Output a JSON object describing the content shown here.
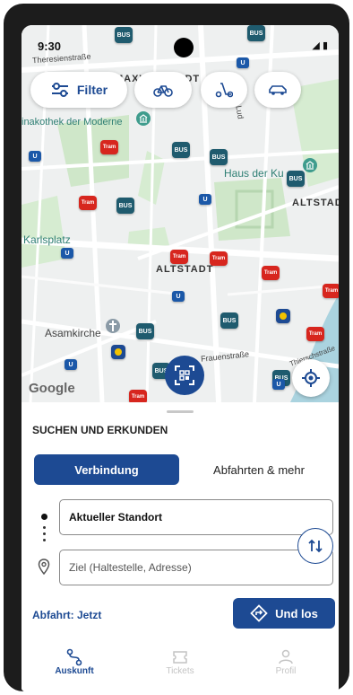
{
  "status_bar": {
    "time": "9:30",
    "indicators": "◢ ▮"
  },
  "filters": {
    "filter_label": "Filter",
    "bike_icon": "bike-icon",
    "scooter_icon": "scooter-icon",
    "car_icon": "car-icon"
  },
  "map": {
    "labels": {
      "maxvorstadt": "MAXVORSTADT",
      "theresienstrasse": "Theresienstraße",
      "pinakothek": "inakothek der Moderne",
      "ludwig": "Lud",
      "haus_der_kunst": "Haus der Ku",
      "altstadt_right": "ALTSTADT",
      "karlsplatz": "Karlsplatz",
      "altstadt_center": "ALTSTADT",
      "asamkirche": "Asamkirche",
      "frauenstrasse": "Frauenstraße",
      "thierschstrasse": "Thierschstraße"
    },
    "google_label": "Google",
    "bus_label": "BUS",
    "tram_label": "Tram",
    "ubahn_label": "U"
  },
  "sheet": {
    "title": "SUCHEN UND ERKUNDEN",
    "segments": {
      "active": "Verbindung",
      "inactive": "Abfahrten & mehr"
    },
    "from_value": "Aktueller Standort",
    "to_placeholder": "Ziel (Haltestelle, Adresse)",
    "departure": "Abfahrt: Jetzt",
    "go_button": "Und los"
  },
  "nav": {
    "items": [
      {
        "label": "Auskunft",
        "active": true
      },
      {
        "label": "Tickets",
        "active": false
      },
      {
        "label": "Profil",
        "active": false
      }
    ]
  },
  "colors": {
    "primary": "#1d4a93",
    "bus": "#1f5b6e",
    "tram": "#d7261e",
    "ubahn": "#1b58a8",
    "park": "#cfe7c9"
  }
}
